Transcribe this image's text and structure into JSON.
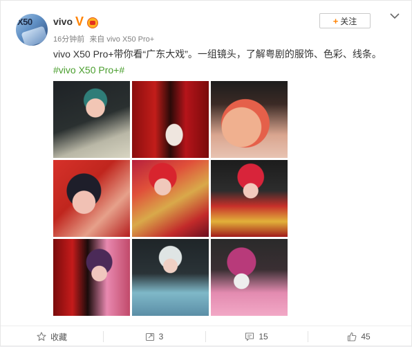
{
  "post": {
    "author": {
      "name": "vivo",
      "avatar_text": "X50",
      "verified_badge": "V",
      "verified_color": "#ff8200"
    },
    "meta": {
      "time": "16分钟前",
      "source": "来自 vivo X50 Pro+"
    },
    "follow_label": "关注",
    "follow_plus": "+",
    "menu_icon": "chevron-down-icon",
    "text": "vivo X50 Pro+带你看“广东大戏”。一组镜头，了解粤剧的服饰、色彩、线条。",
    "hashtag": "#vivo X50 Pro+#",
    "hashtag_color": "#4a9e2e",
    "image_count": 9
  },
  "actions": {
    "favorite": {
      "label": "收藏",
      "icon": "star-icon"
    },
    "repost": {
      "count": "3",
      "icon": "repost-icon"
    },
    "comment": {
      "count": "15",
      "icon": "comment-icon"
    },
    "like": {
      "count": "45",
      "icon": "thumbs-up-icon"
    }
  }
}
